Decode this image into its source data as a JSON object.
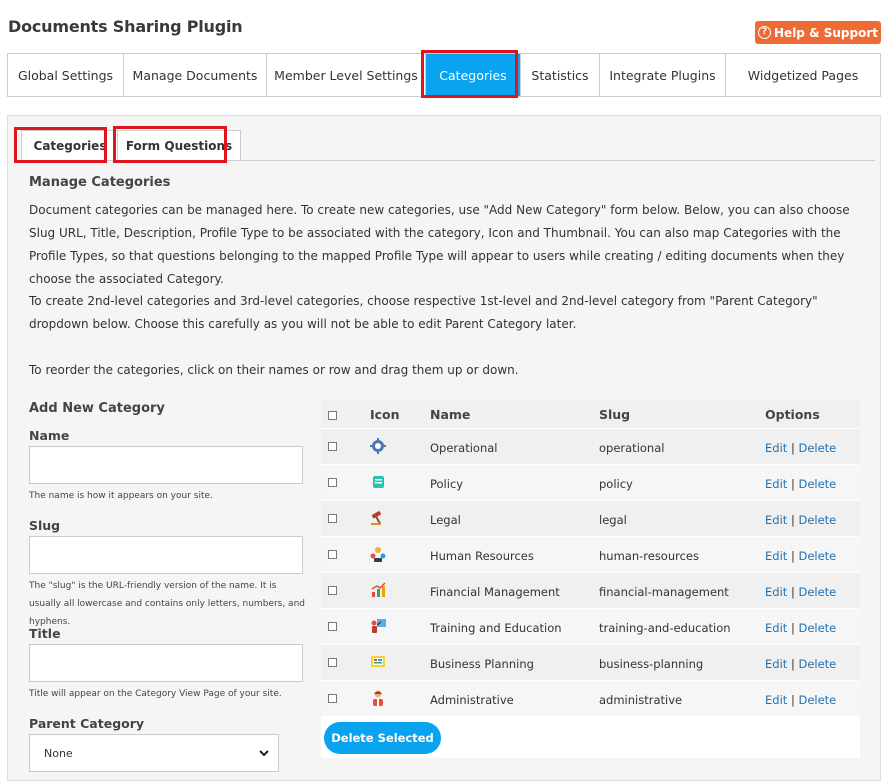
{
  "page_title": "Documents Sharing Plugin",
  "help_button": "Help & Support",
  "tabs": [
    {
      "label": "Global Settings",
      "active": false
    },
    {
      "label": "Manage Documents",
      "active": false
    },
    {
      "label": "Member Level Settings",
      "active": false
    },
    {
      "label": "Categories",
      "active": true
    },
    {
      "label": "Statistics",
      "active": false
    },
    {
      "label": "Integrate Plugins",
      "active": false
    },
    {
      "label": "Widgetized Pages",
      "active": false
    }
  ],
  "subtabs": [
    {
      "label": "Categories",
      "active": true
    },
    {
      "label": "Form Questions",
      "active": false
    }
  ],
  "section_heading": "Manage Categories",
  "paragraphs": [
    "Document categories can be managed here. To create new categories, use \"Add New Category\" form below. Below, you can also choose Slug URL, Title, Description, Profile Type to be associated with the category, Icon and Thumbnail. You can also map Categories with the Profile Types, so that questions belonging to the mapped Profile Type will appear to users while creating / editing documents when they choose the associated Category.",
    "To create 2nd-level categories and 3rd-level categories, choose respective 1st-level and 2nd-level category from \"Parent Category\" dropdown below. Choose this carefully as you will not be able to edit Parent Category later.",
    "To reorder the categories, click on their names or row and drag them up or down."
  ],
  "form": {
    "heading": "Add New Category",
    "name_label": "Name",
    "name_value": "",
    "name_hint": "The name is how it appears on your site.",
    "slug_label": "Slug",
    "slug_value": "",
    "slug_hint": "The \"slug\" is the URL-friendly version of the name. It is usually all lowercase and contains only letters, numbers, and hyphens.",
    "title_label": "Title",
    "title_value": "",
    "title_hint": "Title will appear on the Category View Page of your site.",
    "parent_label": "Parent Category",
    "parent_value": "None"
  },
  "table": {
    "columns": [
      "Icon",
      "Name",
      "Slug",
      "Options"
    ],
    "rows": [
      {
        "icon": "gear-icon",
        "name": "Operational",
        "slug": "operational",
        "edit": "Edit",
        "sep": "|",
        "delete": "Delete"
      },
      {
        "icon": "scroll-icon",
        "name": "Policy",
        "slug": "policy",
        "edit": "Edit",
        "sep": "|",
        "delete": "Delete"
      },
      {
        "icon": "gavel-icon",
        "name": "Legal",
        "slug": "legal",
        "edit": "Edit",
        "sep": "|",
        "delete": "Delete"
      },
      {
        "icon": "people-icon",
        "name": "Human Resources",
        "slug": "human-resources",
        "edit": "Edit",
        "sep": "|",
        "delete": "Delete"
      },
      {
        "icon": "finance-chart-icon",
        "name": "Financial Management",
        "slug": "financial-management",
        "edit": "Edit",
        "sep": "|",
        "delete": "Delete"
      },
      {
        "icon": "teacher-icon",
        "name": "Training and Education",
        "slug": "training-and-education",
        "edit": "Edit",
        "sep": "|",
        "delete": "Delete"
      },
      {
        "icon": "planning-board-icon",
        "name": "Business Planning",
        "slug": "business-planning",
        "edit": "Edit",
        "sep": "|",
        "delete": "Delete"
      },
      {
        "icon": "person-icon",
        "name": "Administrative",
        "slug": "administrative",
        "edit": "Edit",
        "sep": "|",
        "delete": "Delete"
      }
    ],
    "delete_selected": "Delete Selected"
  },
  "colors": {
    "accent": "#0aa3f0",
    "help": "#ef6b35",
    "highlight": "#e0141e",
    "link": "#2271b1"
  }
}
